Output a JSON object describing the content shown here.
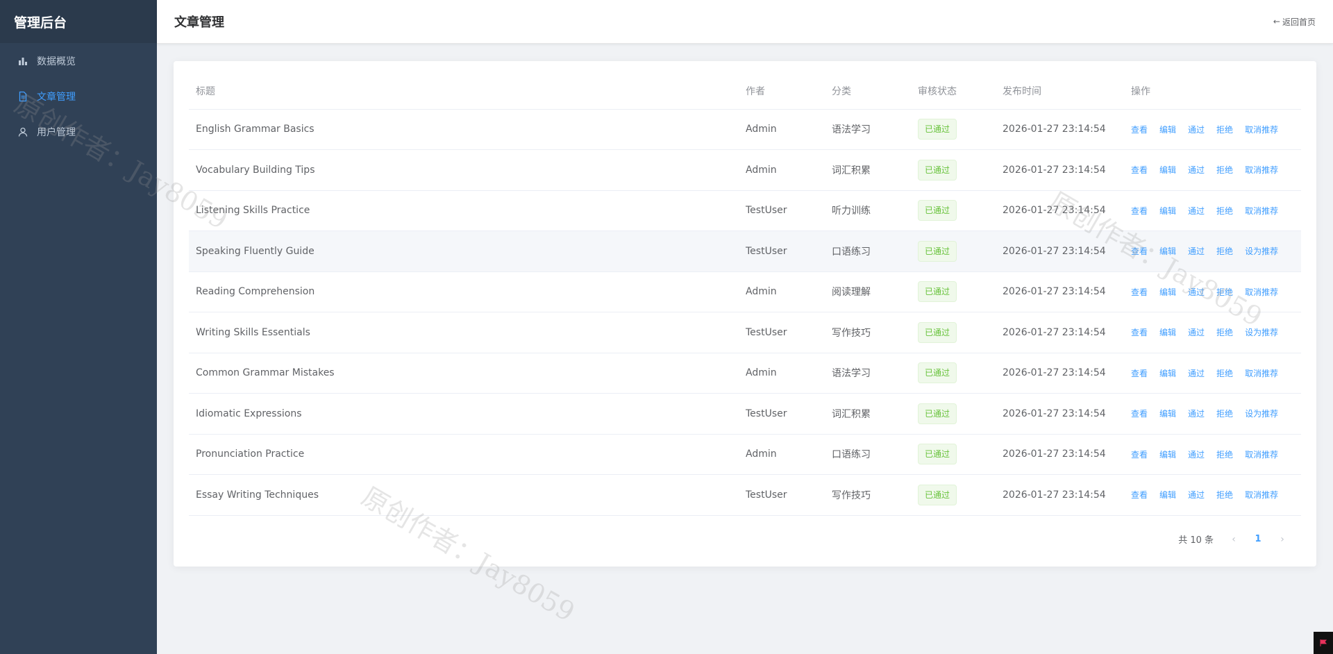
{
  "sidebar": {
    "brand": "管理后台",
    "items": [
      {
        "label": "数据概览",
        "icon": "bar-chart-icon",
        "active": false
      },
      {
        "label": "文章管理",
        "icon": "document-icon",
        "active": true
      },
      {
        "label": "用户管理",
        "icon": "user-icon",
        "active": false
      }
    ]
  },
  "header": {
    "title": "文章管理",
    "back_label": "返回首页"
  },
  "table": {
    "columns": [
      "标题",
      "作者",
      "分类",
      "审核状态",
      "发布时间",
      "操作"
    ],
    "rows": [
      {
        "title": "English Grammar Basics",
        "author": "Admin",
        "category": "语法学习",
        "status": "已通过",
        "time": "2026-01-27 23:14:54",
        "ops": [
          "查看",
          "编辑",
          "通过",
          "拒绝",
          "取消推荐"
        ]
      },
      {
        "title": "Vocabulary Building Tips",
        "author": "Admin",
        "category": "词汇积累",
        "status": "已通过",
        "time": "2026-01-27 23:14:54",
        "ops": [
          "查看",
          "编辑",
          "通过",
          "拒绝",
          "取消推荐"
        ]
      },
      {
        "title": "Listening Skills Practice",
        "author": "TestUser",
        "category": "听力训练",
        "status": "已通过",
        "time": "2026-01-27 23:14:54",
        "ops": [
          "查看",
          "编辑",
          "通过",
          "拒绝",
          "取消推荐"
        ]
      },
      {
        "title": "Speaking Fluently Guide",
        "author": "TestUser",
        "category": "口语练习",
        "status": "已通过",
        "time": "2026-01-27 23:14:54",
        "ops": [
          "查看",
          "编辑",
          "通过",
          "拒绝",
          "设为推荐"
        ]
      },
      {
        "title": "Reading Comprehension",
        "author": "Admin",
        "category": "阅读理解",
        "status": "已通过",
        "time": "2026-01-27 23:14:54",
        "ops": [
          "查看",
          "编辑",
          "通过",
          "拒绝",
          "取消推荐"
        ]
      },
      {
        "title": "Writing Skills Essentials",
        "author": "TestUser",
        "category": "写作技巧",
        "status": "已通过",
        "time": "2026-01-27 23:14:54",
        "ops": [
          "查看",
          "编辑",
          "通过",
          "拒绝",
          "设为推荐"
        ]
      },
      {
        "title": "Common Grammar Mistakes",
        "author": "Admin",
        "category": "语法学习",
        "status": "已通过",
        "time": "2026-01-27 23:14:54",
        "ops": [
          "查看",
          "编辑",
          "通过",
          "拒绝",
          "取消推荐"
        ]
      },
      {
        "title": "Idiomatic Expressions",
        "author": "TestUser",
        "category": "词汇积累",
        "status": "已通过",
        "time": "2026-01-27 23:14:54",
        "ops": [
          "查看",
          "编辑",
          "通过",
          "拒绝",
          "设为推荐"
        ]
      },
      {
        "title": "Pronunciation Practice",
        "author": "Admin",
        "category": "口语练习",
        "status": "已通过",
        "time": "2026-01-27 23:14:54",
        "ops": [
          "查看",
          "编辑",
          "通过",
          "拒绝",
          "取消推荐"
        ]
      },
      {
        "title": "Essay Writing Techniques",
        "author": "TestUser",
        "category": "写作技巧",
        "status": "已通过",
        "time": "2026-01-27 23:14:54",
        "ops": [
          "查看",
          "编辑",
          "通过",
          "拒绝",
          "取消推荐"
        ]
      }
    ]
  },
  "pagination": {
    "total_label": "共 10 条",
    "current_page": "1"
  },
  "watermark": {
    "text": "原创作者：Jay8059"
  },
  "colors": {
    "sidebar_bg": "#304156",
    "accent": "#409eff",
    "success": "#67c23a"
  }
}
